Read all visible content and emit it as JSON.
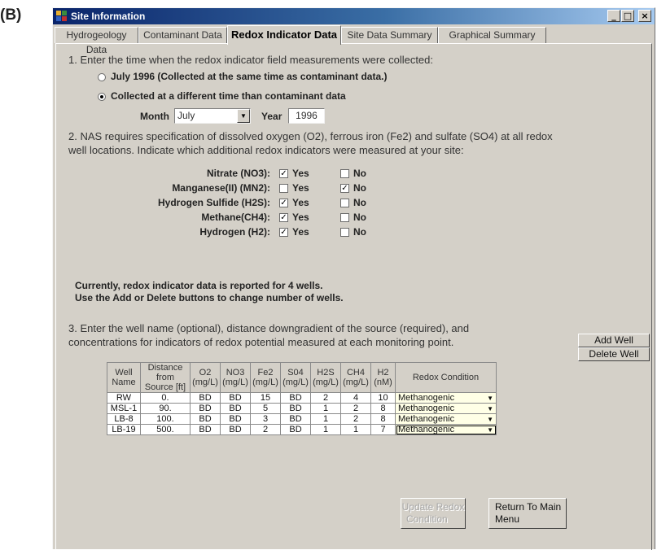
{
  "figure_label": "(B)",
  "window": {
    "title": "Site Information",
    "minimize": "_",
    "maximize": "□",
    "close": "×"
  },
  "tabs": [
    {
      "label": "Hydrogeology Data",
      "active": false
    },
    {
      "label": "Contaminant Data",
      "active": false
    },
    {
      "label": "Redox Indicator Data",
      "active": true
    },
    {
      "label": "Site Data Summary",
      "active": false
    },
    {
      "label": "Graphical Summary",
      "active": false
    }
  ],
  "step1": {
    "prompt": "1. Enter the time when the redox indicator field measurements were collected:",
    "option_same": "July  1996 (Collected at the same time as contaminant data.)",
    "option_different": "Collected at a different time than contaminant data",
    "selected": "different",
    "month_label": "Month",
    "month_value": "July",
    "year_label": "Year",
    "year_value": "1996"
  },
  "step2": {
    "prompt_line1": "2. NAS requires specification of dissolved oxygen (O2), ferrous iron (Fe2) and sulfate (SO4) at all redox",
    "prompt_line2": "well locations. Indicate which additional redox indicators were measured at your site:",
    "yes_label": "Yes",
    "no_label": "No",
    "indicators": [
      {
        "label": "Nitrate (NO3):",
        "yes": true,
        "no": false
      },
      {
        "label": "Manganese(II) (MN2):",
        "yes": false,
        "no": true
      },
      {
        "label": "Hydrogen Sulfide (H2S):",
        "yes": true,
        "no": false
      },
      {
        "label": "Methane(CH4):",
        "yes": true,
        "no": false
      },
      {
        "label": "Hydrogen (H2):",
        "yes": true,
        "no": false
      }
    ]
  },
  "notice": {
    "line1": "Currently, redox indicator data is reported for 4 wells.",
    "line2": "Use the Add or Delete buttons to change number of wells."
  },
  "step3": {
    "prompt_line1": "3. Enter the well name (optional), distance downgradient of the source (required), and",
    "prompt_line2": "concentrations for indicators of redox potential measured at each monitoring point.",
    "add_well": "Add Well",
    "delete_well": "Delete Well"
  },
  "table": {
    "headers": [
      [
        "Well",
        "Name"
      ],
      [
        "Distance from",
        "Source [ft]"
      ],
      [
        "O2",
        "(mg/L)"
      ],
      [
        "NO3",
        "(mg/L)"
      ],
      [
        "Fe2",
        "(mg/L)"
      ],
      [
        "S04",
        "(mg/L)"
      ],
      [
        "H2S",
        "(mg/L)"
      ],
      [
        "CH4",
        "(mg/L)"
      ],
      [
        "H2 (nM)"
      ],
      [
        "Redox Condition"
      ]
    ],
    "rows": [
      [
        "RW",
        "0.",
        "BD",
        "BD",
        "15",
        "BD",
        "2",
        "4",
        "10",
        "Methanogenic"
      ],
      [
        "MSL-1",
        "90.",
        "BD",
        "BD",
        "5",
        "BD",
        "1",
        "2",
        "8",
        "Methanogenic"
      ],
      [
        "LB-8",
        "100.",
        "BD",
        "BD",
        "3",
        "BD",
        "1",
        "2",
        "8",
        "Methanogenic"
      ],
      [
        "LB-19",
        "500.",
        "BD",
        "BD",
        "2",
        "BD",
        "1",
        "1",
        "7",
        "Methanogenic"
      ]
    ]
  },
  "buttons": {
    "update_line1": "Update Redox",
    "update_line2": "Condition",
    "return_line1": "Return To Main",
    "return_line2": "Menu"
  }
}
